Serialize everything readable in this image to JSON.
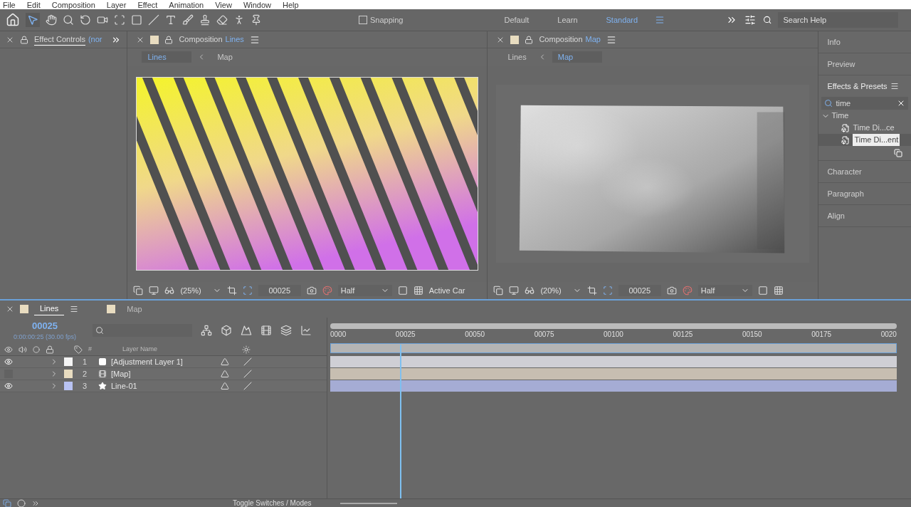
{
  "menu": [
    "File",
    "Edit",
    "Composition",
    "Layer",
    "Effect",
    "Animation",
    "View",
    "Window",
    "Help"
  ],
  "toolbar": {
    "snapping": {
      "label": "Snapping",
      "checked": false
    },
    "workspaces": [
      {
        "label": "Default",
        "selected": false
      },
      {
        "label": "Learn",
        "selected": false
      },
      {
        "label": "Standard",
        "selected": true
      }
    ],
    "search_help": {
      "placeholder": "Search Help"
    }
  },
  "effect_controls": {
    "title": "Effect Controls",
    "layer": "(nor"
  },
  "viewers": [
    {
      "title": "Composition",
      "name": "Lines",
      "breadcrumbs": [
        {
          "label": "Lines",
          "selected": true
        },
        {
          "label": "Map",
          "selected": false
        }
      ],
      "zoom": "(25%)",
      "frame": "00025",
      "resolution": "Half",
      "camera": "Active Car",
      "kind": "stripes"
    },
    {
      "title": "Composition",
      "name": "Map",
      "breadcrumbs": [
        {
          "label": "Lines",
          "selected": false
        },
        {
          "label": "Map",
          "selected": true
        }
      ],
      "zoom": "(20%)",
      "frame": "00025",
      "resolution": "Half",
      "kind": "gradient"
    }
  ],
  "side_panels": [
    {
      "title": "Info",
      "expanded": false
    },
    {
      "title": "Preview",
      "expanded": false
    },
    {
      "title": "Effects & Presets",
      "expanded": true,
      "search": "time",
      "tree": [
        {
          "label": "Time",
          "expanded": true,
          "children": [
            {
              "label": "Time Di...ce",
              "selected": false
            },
            {
              "label": "Time Di...ent",
              "selected": true
            }
          ]
        }
      ]
    },
    {
      "title": "Character",
      "expanded": false
    },
    {
      "title": "Paragraph",
      "expanded": false
    },
    {
      "title": "Align",
      "expanded": false
    }
  ],
  "timeline": {
    "tabs": [
      {
        "label": "Lines",
        "selected": true,
        "color": "#e8dcc0"
      },
      {
        "label": "Map",
        "selected": false,
        "color": "#e8dcc0"
      }
    ],
    "current_time": "00025",
    "timecode": "0:00:00:25 (30.00 fps)",
    "columns": [
      "#",
      "Layer Name"
    ],
    "layers": [
      {
        "number": "1",
        "name": "[Adjustment Layer 1]",
        "color": "#f4f4f4",
        "visible": true,
        "kind": "adjustment"
      },
      {
        "number": "2",
        "name": "[Map]",
        "color": "#e8dcc0",
        "visible": false,
        "kind": "precomp"
      },
      {
        "number": "3",
        "name": "Line-01",
        "color": "#b8c2f2",
        "visible": true,
        "kind": "shape"
      }
    ],
    "ruler": [
      "0000",
      "00025",
      "00050",
      "00075",
      "00100",
      "00125",
      "00150",
      "00175",
      "0020"
    ],
    "playhead": {
      "level": 0.125
    }
  },
  "status_bar": {
    "toggle": "Toggle Switches / Modes"
  }
}
